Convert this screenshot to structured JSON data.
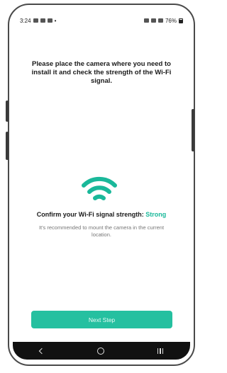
{
  "status_bar": {
    "time": "3:24",
    "battery": "76%"
  },
  "instruction": "Please place the camera where you need to install it and check the strength of the Wi-Fi signal.",
  "signal": {
    "label": "Confirm your Wi-Fi signal strength:",
    "value": "Strong",
    "icon": "wifi-icon",
    "color": "#1ab89a"
  },
  "recommendation": "It's recommended to mount the camera in the current location.",
  "next_button": {
    "label": "Next Step",
    "color": "#25c0a0"
  },
  "nav_bar": {
    "icons": [
      "back-icon",
      "home-icon",
      "recents-icon"
    ]
  }
}
